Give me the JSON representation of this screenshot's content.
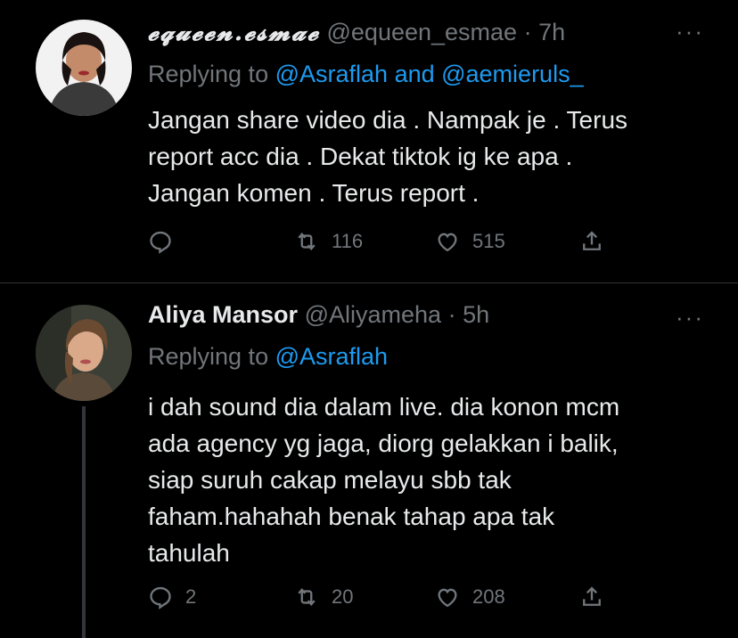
{
  "tweets": [
    {
      "display_name": "𝓮𝓺𝓾𝓮𝓮𝓷.𝓮𝓼𝓶𝓪𝓮",
      "handle": "@equeen_esmae",
      "separator": "·",
      "time": "7h",
      "replying_prefix": "Replying to",
      "replying_mentions": "@Asraflah and @aemieruls_",
      "body_lines": [
        "Jangan share video dia . Nampak je . Terus",
        "report acc dia . Dekat tiktok ig ke apa .",
        "Jangan komen . Terus report ."
      ],
      "reply_count": "",
      "retweet_count": "116",
      "like_count": "515"
    },
    {
      "display_name": "Aliya Mansor",
      "handle": "@Aliyameha",
      "separator": "·",
      "time": "5h",
      "replying_prefix": "Replying to",
      "replying_mentions": "@Asraflah",
      "body_lines": [
        "i dah sound dia dalam live. dia konon mcm",
        "ada agency yg jaga, diorg gelakkan i balik,",
        "siap suruh cakap melayu sbb tak",
        "faham.hahahah benak tahap apa tak",
        "tahulah"
      ],
      "reply_count": "2",
      "retweet_count": "20",
      "like_count": "208"
    }
  ],
  "more_label": "···",
  "colors": {
    "background": "#000000",
    "text_primary": "#e7e9ea",
    "text_secondary": "#71767b",
    "accent": "#1d9bf0",
    "divider": "#2f3336"
  },
  "icons": [
    "reply-icon",
    "retweet-icon",
    "like-icon",
    "share-icon",
    "more-icon"
  ]
}
